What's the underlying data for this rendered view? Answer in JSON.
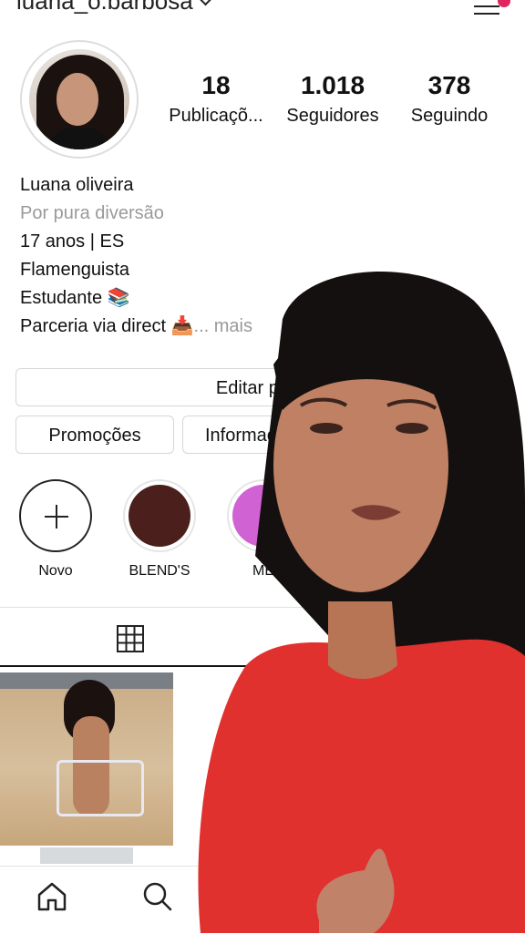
{
  "header": {
    "username": "luana_o.barbosa"
  },
  "profile": {
    "stats": [
      {
        "value": "18",
        "label": "Publicaçõ..."
      },
      {
        "value": "1.018",
        "label": "Seguidores"
      },
      {
        "value": "378",
        "label": "Seguindo"
      }
    ],
    "bio": {
      "name": "Luana oliveira",
      "category": "Por pura diversão",
      "line1": "17 anos | ES",
      "line2": "Flamenguista",
      "line3": "Estudante 📚",
      "line4": "Parceria via direct 📥",
      "more": "... mais"
    }
  },
  "buttons": {
    "edit": "Editar perfil",
    "promotions": "Promoções",
    "info": "Informações"
  },
  "highlights": [
    {
      "label": "Novo",
      "color": "#ffffff"
    },
    {
      "label": "BLEND'S",
      "color": "#4a1f1c"
    },
    {
      "label": "ME",
      "color": "#d062d3"
    }
  ],
  "colors": {
    "notification": "#e0245e",
    "overlay_shirt": "#e0312e"
  },
  "icons": {
    "menu": "menu-icon",
    "grid": "grid-icon",
    "home": "home-icon",
    "search": "search-icon"
  }
}
